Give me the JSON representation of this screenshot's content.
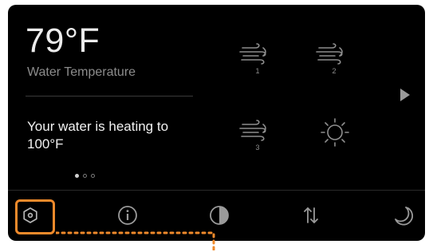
{
  "current": {
    "temperature": "79°F",
    "label": "Water Temperature"
  },
  "status": {
    "message": "Your water is heating to 100°F"
  },
  "pager": {
    "count": 3,
    "active": 1
  },
  "modes": [
    {
      "icon": "heat-element-1-icon",
      "number": "1"
    },
    {
      "icon": "heat-element-2-icon",
      "number": "2"
    },
    {
      "icon": "heat-element-3-icon",
      "number": "3"
    },
    {
      "icon": "sun-icon",
      "number": ""
    }
  ],
  "bottom_bar": [
    {
      "icon": "settings-icon",
      "highlighted": true
    },
    {
      "icon": "info-icon",
      "highlighted": false
    },
    {
      "icon": "contrast-icon",
      "highlighted": false
    },
    {
      "icon": "sort-arrows-icon",
      "highlighted": false
    },
    {
      "icon": "moon-icon",
      "highlighted": false
    }
  ],
  "colors": {
    "screen_bg": "#000000",
    "primary_text": "#ececec",
    "secondary_text": "#8c8c8c",
    "icon": "#9a9a9a",
    "highlight": "#f08a2b"
  }
}
